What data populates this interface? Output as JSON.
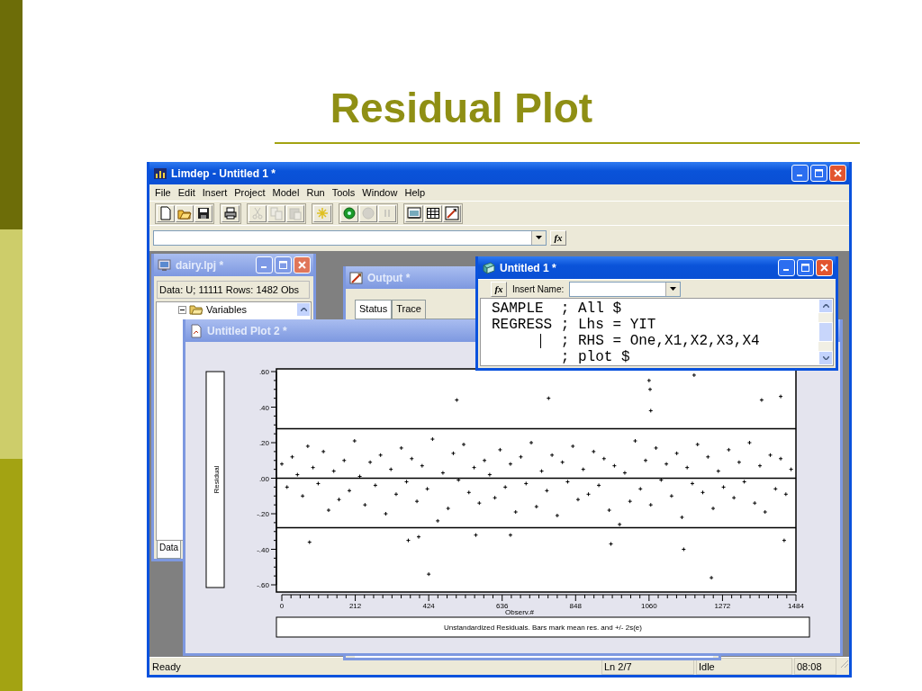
{
  "slide": {
    "title": "Residual Plot"
  },
  "app": {
    "title": "Limdep - Untitled 1 *",
    "active": true,
    "menu": [
      "File",
      "Edit",
      "Insert",
      "Project",
      "Model",
      "Run",
      "Tools",
      "Window",
      "Help"
    ],
    "toolbar": [
      {
        "disabled": false
      },
      {
        "disabled": false
      },
      {
        "disabled": false
      },
      {
        "disabled": false
      },
      {
        "disabled": true
      },
      {
        "disabled": true
      },
      {
        "disabled": true
      },
      {
        "disabled": false
      },
      {
        "disabled": false
      },
      {
        "disabled": true
      },
      {
        "disabled": true
      },
      {
        "disabled": false
      },
      {
        "disabled": false
      },
      {
        "disabled": false
      }
    ],
    "formula_bar": {
      "fx": "fx"
    },
    "windows": [
      {
        "kind": "output",
        "title": "Output *",
        "active": false,
        "tabs": [
          {
            "label": "Status",
            "selected": true
          },
          {
            "label": "Trace",
            "selected": false
          }
        ]
      },
      {
        "kind": "project",
        "title": "dairy.lpj *",
        "active": false,
        "controls": true,
        "info": "Data: U; 11111 Rows: 1482 Obs",
        "tree": [
          {
            "label": "Variables",
            "expanded": true
          }
        ],
        "tab": "Data"
      },
      {
        "kind": "plot",
        "title": "Untitled Plot 2 *",
        "active": false,
        "chart_data": {
          "type": "scatter",
          "title": "Unstandardized Residuals. Bars mark mean res. and +/- 2s(e)",
          "xlabel": "Observ.#",
          "x": [
            0,
            15,
            30,
            45,
            60,
            75,
            90,
            105,
            120,
            135,
            150,
            165,
            180,
            195,
            210,
            225,
            240,
            255,
            270,
            285,
            300,
            315,
            330,
            345,
            360,
            375,
            390,
            405,
            420,
            435,
            450,
            465,
            480,
            495,
            510,
            525,
            540,
            555,
            570,
            585,
            600,
            615,
            630,
            645,
            660,
            675,
            690,
            705,
            720,
            735,
            750,
            765,
            780,
            795,
            810,
            825,
            840,
            855,
            870,
            885,
            900,
            915,
            930,
            945,
            960,
            975,
            990,
            1005,
            1020,
            1035,
            1050,
            1065,
            1080,
            1095,
            1110,
            1125,
            1140,
            1155,
            1170,
            1185,
            1200,
            1215,
            1230,
            1245,
            1260,
            1275,
            1290,
            1305,
            1320,
            1335,
            1350,
            1365,
            1380,
            1395,
            1410,
            1425,
            1440,
            1455,
            1470,
            505,
            770,
            1060,
            1063,
            1065,
            1190,
            1385,
            1440,
            80,
            365,
            424,
            560,
            660,
            1240,
            1160,
            1450,
            395,
            950
          ],
          "series": [
            {
              "color": "#000000",
              "values": [
                0.08,
                -0.05,
                0.12,
                0.02,
                -0.1,
                0.18,
                0.06,
                -0.03,
                0.15,
                -0.18,
                0.04,
                -0.12,
                0.1,
                -0.07,
                0.21,
                0.01,
                -0.15,
                0.09,
                -0.04,
                0.13,
                -0.2,
                0.05,
                -0.09,
                0.17,
                -0.02,
                0.11,
                -0.13,
                0.07,
                -0.06,
                0.22,
                -0.24,
                0.03,
                -0.17,
                0.14,
                -0.01,
                0.19,
                -0.08,
                0.06,
                -0.14,
                0.1,
                0.02,
                -0.11,
                0.16,
                -0.05,
                0.08,
                -0.19,
                0.12,
                -0.03,
                0.2,
                -0.16,
                0.04,
                -0.07,
                0.13,
                -0.21,
                0.09,
                -0.02,
                0.18,
                -0.12,
                0.05,
                -0.09,
                0.15,
                -0.04,
                0.11,
                -0.18,
                0.07,
                -0.26,
                0.03,
                -0.13,
                0.21,
                -0.06,
                0.1,
                -0.15,
                0.17,
                -0.01,
                0.08,
                -0.1,
                0.14,
                -0.22,
                0.06,
                -0.03,
                0.19,
                -0.08,
                0.12,
                -0.17,
                0.04,
                -0.05,
                0.16,
                -0.11,
                0.09,
                -0.02,
                0.2,
                -0.14,
                0.07,
                -0.19,
                0.13,
                -0.06,
                0.11,
                -0.09,
                0.05,
                0.44,
                0.45,
                0.55,
                0.5,
                0.38,
                0.58,
                0.44,
                0.46,
                -0.36,
                -0.35,
                -0.54,
                -0.32,
                -0.32,
                -0.56,
                -0.4,
                -0.35,
                -0.33,
                -0.37
              ]
            }
          ],
          "xlim": [
            0,
            1484
          ],
          "ylim": [
            -0.6,
            0.6
          ],
          "xticks": [
            0,
            212,
            424,
            636,
            848,
            1060,
            1272,
            1484
          ],
          "yticks": [
            {
              "value": 0.6,
              "label": ".60"
            },
            {
              "value": 0.4,
              "label": ".40"
            },
            {
              "value": 0.2,
              "label": ".20"
            },
            {
              "value": 0,
              "label": ".00"
            },
            {
              "value": -0.2,
              "label": "-.20"
            },
            {
              "value": -0.4,
              "label": "-.40"
            },
            {
              "value": -0.6,
              "label": "-.60"
            }
          ],
          "ref_lines": [
            {
              "axis": "y",
              "value": 0.278
            },
            {
              "axis": "y",
              "value": 0
            },
            {
              "axis": "y",
              "value": -0.278
            }
          ],
          "annotations": [
            {
              "text": "Residual"
            }
          ]
        }
      },
      {
        "kind": "editor",
        "title": "Untitled 1 *",
        "active": true,
        "controls": true,
        "fx": "fx",
        "insert_label": "Insert Name:",
        "lines": [
          {
            "text": "SAMPLE  ; All $",
            "cursor": false
          },
          {
            "text": "REGRESS ; Lhs = YIT",
            "cursor": false
          },
          {
            "text": "        ; RHS = One,X1,X2,X3,X4",
            "cursor": true
          },
          {
            "text": "        ; plot $",
            "cursor": false
          }
        ]
      }
    ],
    "status_bar": [
      "Ready",
      "Ln 2/7",
      "Idle",
      "08:08"
    ]
  }
}
